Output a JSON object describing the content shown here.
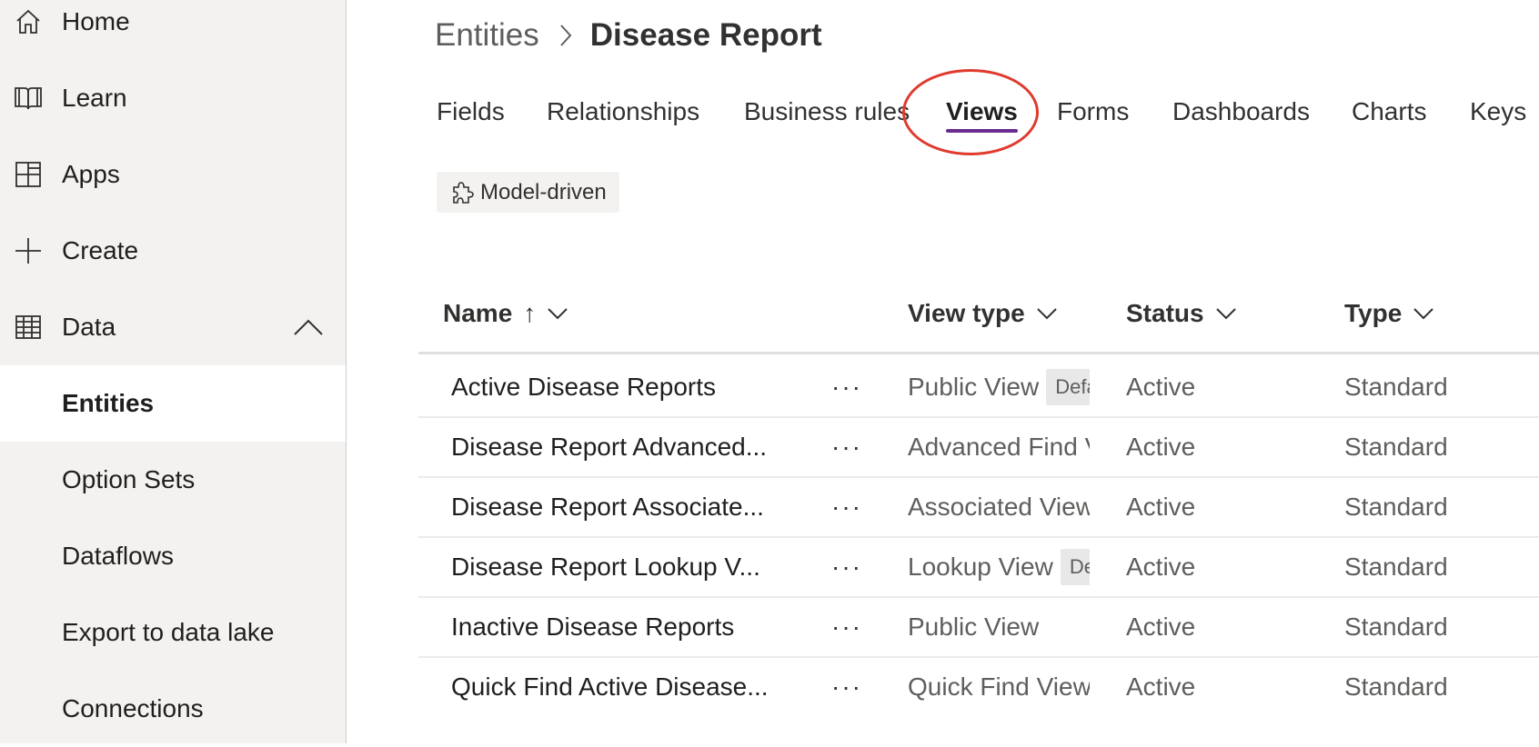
{
  "sidebar": {
    "items": [
      {
        "label": "Home",
        "icon": "home-icon"
      },
      {
        "label": "Learn",
        "icon": "book-icon"
      },
      {
        "label": "Apps",
        "icon": "apps-icon"
      },
      {
        "label": "Create",
        "icon": "plus-icon"
      },
      {
        "label": "Data",
        "icon": "table-icon",
        "expanded": true
      },
      {
        "label": "Entities",
        "selected": true
      },
      {
        "label": "Option Sets"
      },
      {
        "label": "Dataflows"
      },
      {
        "label": "Export to data lake"
      },
      {
        "label": "Connections"
      }
    ]
  },
  "breadcrumb": {
    "parent": "Entities",
    "current": "Disease Report"
  },
  "tabs": [
    {
      "label": "Fields"
    },
    {
      "label": "Relationships"
    },
    {
      "label": "Business rules"
    },
    {
      "label": "Views",
      "selected": true
    },
    {
      "label": "Forms"
    },
    {
      "label": "Dashboards"
    },
    {
      "label": "Charts"
    },
    {
      "label": "Keys"
    }
  ],
  "filter": {
    "label": "Model-driven",
    "icon": "puzzle-icon"
  },
  "table": {
    "columns": {
      "name": "Name",
      "name_sort": "↑",
      "view_type": "View type",
      "status": "Status",
      "type": "Type"
    },
    "more_label": "···",
    "rows": [
      {
        "name": "Active Disease Reports",
        "view_type": "Public View",
        "badge": "Defa",
        "status": "Active",
        "type": "Standard"
      },
      {
        "name": "Disease Report Advanced...",
        "view_type": "Advanced Find V",
        "badge": "",
        "status": "Active",
        "type": "Standard"
      },
      {
        "name": "Disease Report Associate...",
        "view_type": "Associated View",
        "badge": "",
        "status": "Active",
        "type": "Standard"
      },
      {
        "name": "Disease Report Lookup V...",
        "view_type": "Lookup View",
        "badge": "De",
        "status": "Active",
        "type": "Standard"
      },
      {
        "name": "Inactive Disease Reports",
        "view_type": "Public View",
        "badge": "",
        "status": "Active",
        "type": "Standard"
      },
      {
        "name": "Quick Find Active Disease...",
        "view_type": "Quick Find View",
        "badge": "",
        "status": "Active",
        "type": "Standard"
      }
    ]
  },
  "colors": {
    "sidebar_bg": "#f3f2f1",
    "selected_tab_underline": "#6b2c91",
    "annotation_circle": "#e03a2e"
  }
}
